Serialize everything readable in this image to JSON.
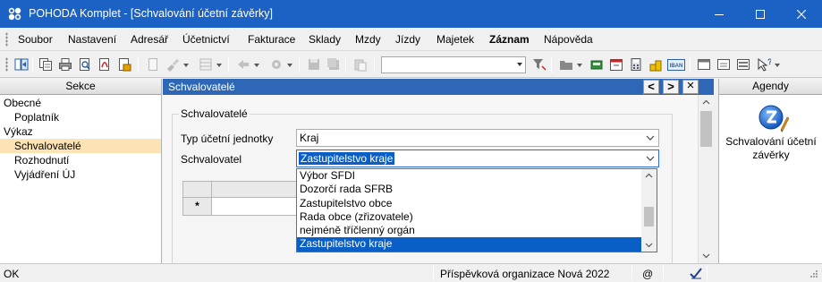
{
  "window": {
    "title": "POHODA Komplet - [Schvalování účetní závěrky]",
    "controls": {
      "minimize": "minimize-icon",
      "maximize": "maximize-icon",
      "close": "close-icon"
    }
  },
  "menu": {
    "items": [
      {
        "label": "Soubor"
      },
      {
        "label": "Nastavení"
      },
      {
        "label": "Adresář"
      },
      {
        "label": "Účetnictví"
      },
      {
        "label": "Fakturace"
      },
      {
        "label": "Sklady"
      },
      {
        "label": "Mzdy"
      },
      {
        "label": "Jízdy"
      },
      {
        "label": "Majetek"
      },
      {
        "label": "Záznam"
      },
      {
        "label": "Nápověda"
      }
    ]
  },
  "toolbar": {
    "combo_value": "",
    "iban_label": "IBAN"
  },
  "left_panel": {
    "header": "Sekce",
    "tree": [
      {
        "label": "Obecné"
      },
      {
        "label": "Poplatník"
      },
      {
        "label": "Výkaz"
      },
      {
        "label": "Schvalovatelé"
      },
      {
        "label": "Rozhodnutí"
      },
      {
        "label": "Vyjádření ÚJ"
      }
    ]
  },
  "center": {
    "header": "Schvalovatelé",
    "nav_prev": "<",
    "nav_next": ">",
    "close": "×",
    "group_title": "Schvalovatelé",
    "fields": {
      "unit_type_label": "Typ účetní jednotky",
      "unit_type_value": "Kraj",
      "approver_label": "Schvalovatel",
      "approver_value": "Zastupitelstvo kraje"
    },
    "grid": {
      "row_marker": "*"
    },
    "dropdown_options": [
      {
        "label": "Výbor SFDI"
      },
      {
        "label": "Dozorčí rada SFRB"
      },
      {
        "label": "Zastupitelstvo obce"
      },
      {
        "label": "Rada obce (zřizovatele)"
      },
      {
        "label": "nejméně tříčlenný orgán"
      },
      {
        "label": "Zastupitelstvo kraje"
      }
    ]
  },
  "right_panel": {
    "header": "Agendy",
    "agenda_label_1": "Schvalování účetní",
    "agenda_label_2": "závěrky"
  },
  "status": {
    "left": "OK",
    "organization": "Příspěvková organizace Nová 2022",
    "at": "@"
  },
  "colors": {
    "title_bar": "#1c62c4",
    "center_header": "#2d67b6",
    "selection": "#0a5fc6",
    "tree_selection": "#fce3b3"
  }
}
